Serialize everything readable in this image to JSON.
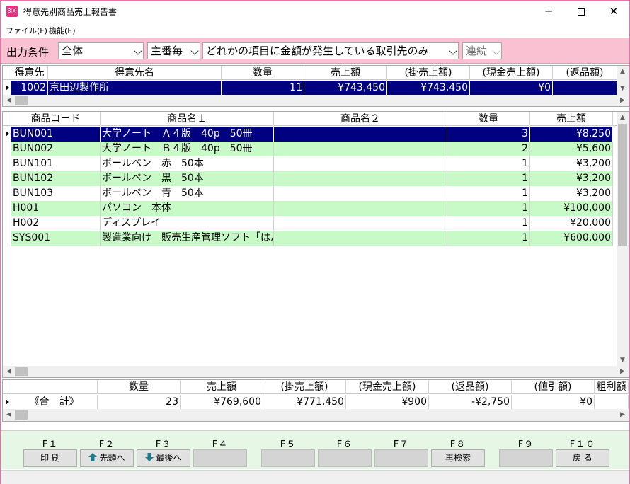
{
  "window": {
    "title": "得意先別商品売上報告書",
    "icon_label": "3Ⓑ",
    "min_glyph": "─",
    "close_glyph": "✕"
  },
  "menu": [
    {
      "label": "ファイル(F)"
    },
    {
      "label": "機能(E)"
    }
  ],
  "conditions": {
    "label": "出力条件",
    "scope": "全体",
    "group": "主番毎",
    "filter": "どれかの項目に金額が発生している取引先のみ",
    "mode": "連続"
  },
  "customer_grid": {
    "columns": [
      "得意先",
      "得意先名",
      "数量",
      "売上額",
      "(掛売上額)",
      "(現金売上額)",
      "(返品額)"
    ],
    "rows": [
      {
        "code": "1002",
        "name": "京田辺製作所",
        "qty": "11",
        "sales": "¥743,450",
        "credit": "¥743,450",
        "cash": "¥0",
        "returns": ""
      }
    ]
  },
  "product_grid": {
    "columns": [
      "商品コード",
      "商品名１",
      "商品名２",
      "数量",
      "売上額"
    ],
    "rows": [
      {
        "code": "BUN001",
        "name1": "大学ノート　Ａ４版　40p　50冊",
        "name2": "",
        "qty": "3",
        "sales": "¥8,250"
      },
      {
        "code": "BUN002",
        "name1": "大学ノート　Ｂ４版　40p　50冊",
        "name2": "",
        "qty": "2",
        "sales": "¥5,600"
      },
      {
        "code": "BUN101",
        "name1": "ボールペン　赤　50本",
        "name2": "",
        "qty": "1",
        "sales": "¥3,200"
      },
      {
        "code": "BUN102",
        "name1": "ボールペン　黒　50本",
        "name2": "",
        "qty": "1",
        "sales": "¥3,200"
      },
      {
        "code": "BUN103",
        "name1": "ボールペン　青　50本",
        "name2": "",
        "qty": "1",
        "sales": "¥3,200"
      },
      {
        "code": "H001",
        "name1": "パソコン　本体",
        "name2": "",
        "qty": "1",
        "sales": "¥100,000"
      },
      {
        "code": "H002",
        "name1": "ディスプレイ",
        "name2": "",
        "qty": "1",
        "sales": "¥20,000"
      },
      {
        "code": "SYS001",
        "name1": "製造業向け　販売生産管理ソフト「はんばいＱ－Ｓ",
        "name2": "",
        "qty": "1",
        "sales": "¥600,000"
      }
    ]
  },
  "total_grid": {
    "columns": [
      "",
      "数量",
      "売上額",
      "(掛売上額)",
      "(現金売上額)",
      "(返品額)",
      "(値引額)",
      "粗利額"
    ],
    "row": {
      "label": "《合　計》",
      "qty": "23",
      "sales": "¥769,600",
      "credit": "¥771,450",
      "cash": "¥900",
      "returns": "-¥2,750",
      "discount": "¥0"
    }
  },
  "function_keys": [
    {
      "key": "F１",
      "label": "印 刷",
      "icon": ""
    },
    {
      "key": "F２",
      "label": "先頭へ",
      "icon": "arrow-up-icon"
    },
    {
      "key": "F３",
      "label": "最後へ",
      "icon": "arrow-down-icon"
    },
    {
      "key": "F４",
      "label": "",
      "icon": ""
    },
    {
      "key": "F５",
      "label": "",
      "icon": ""
    },
    {
      "key": "F６",
      "label": "",
      "icon": ""
    },
    {
      "key": "F７",
      "label": "",
      "icon": ""
    },
    {
      "key": "F８",
      "label": "再検索",
      "icon": ""
    },
    {
      "key": "F９",
      "label": "",
      "icon": ""
    },
    {
      "key": "F１０",
      "label": "戻 る",
      "icon": ""
    }
  ],
  "colors": {
    "selection": "#000080",
    "alt_row": "#c8fac8",
    "condition_bar": "#f9c1d2",
    "fkey_bar": "#e6f7e6",
    "icon_arrow": "#1e7a8c"
  }
}
